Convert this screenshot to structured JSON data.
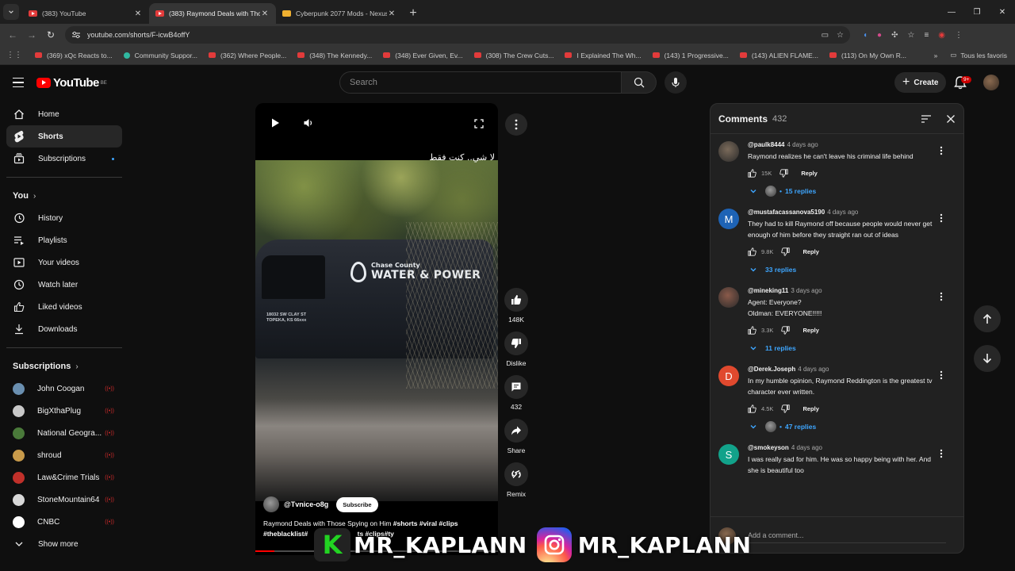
{
  "browser": {
    "tabs": [
      {
        "title": "(383) YouTube",
        "active": false
      },
      {
        "title": "(383) Raymond Deals with Tho",
        "active": true
      },
      {
        "title": "Cyberpunk 2077 Mods - Nexus",
        "active": false
      }
    ],
    "url": "youtube.com/shorts/F-icwB4offY",
    "bookmarks": [
      "(369) xQc Reacts to...",
      "Community Suppor...",
      "(362) Where People...",
      "(348) The Kennedy...",
      "(348) Ever Given, Ev...",
      "(308) The Crew Cuts...",
      "I Explained The Wh...",
      "(143) 1 Progressive...",
      "(143) ALIEN FLAME...",
      "(113) On My Own R..."
    ],
    "all_bookmarks": "Tous les favoris"
  },
  "header": {
    "logo": "YouTube",
    "region": "BE",
    "search_placeholder": "Search",
    "create_label": "Create",
    "notifications": "9+"
  },
  "sidebar": {
    "main": [
      {
        "label": "Home",
        "icon": "home-icon"
      },
      {
        "label": "Shorts",
        "icon": "shorts-icon",
        "active": true
      },
      {
        "label": "Subscriptions",
        "icon": "subscriptions-icon"
      }
    ],
    "you_heading": "You",
    "you": [
      {
        "label": "History",
        "icon": "history-icon"
      },
      {
        "label": "Playlists",
        "icon": "playlists-icon"
      },
      {
        "label": "Your videos",
        "icon": "your-videos-icon"
      },
      {
        "label": "Watch later",
        "icon": "watch-later-icon"
      },
      {
        "label": "Liked videos",
        "icon": "liked-videos-icon"
      },
      {
        "label": "Downloads",
        "icon": "downloads-icon"
      }
    ],
    "subscriptions_heading": "Subscriptions",
    "subscriptions": [
      {
        "label": "John Coogan",
        "color": "#6a8fb0"
      },
      {
        "label": "BigXthaPlug",
        "color": "#c8c8c8"
      },
      {
        "label": "National Geogra...",
        "color": "#4a7a3a"
      },
      {
        "label": "shroud",
        "color": "#c89a4a"
      },
      {
        "label": "Law&Crime Trials",
        "color": "#c0302a"
      },
      {
        "label": "StoneMountain64",
        "color": "#d8d8d8"
      },
      {
        "label": "CNBC",
        "color": "#ffffff"
      }
    ],
    "show_more": "Show more"
  },
  "video": {
    "overlay_text": "لا شي.. كنت فقط",
    "van_small": "Chase County",
    "van_big": "WATER & POWER",
    "van_address": [
      "18032 SW CLAY ST",
      "TOPEKA, KS 66xxx"
    ],
    "channel": "@Tvnice-o8g",
    "subscribe_label": "Subscribe",
    "caption_plain": "Raymond Deals with Those Spying on Him ",
    "caption_tags": "#shorts #viral #clips",
    "caption_line2": "#theblacklist#",
    "caption_line2_tail": "ts #clips#ty",
    "progress": 0.08
  },
  "actions": {
    "likes": "148K",
    "dislike_label": "Dislike",
    "comments": "432",
    "share_label": "Share",
    "remix_label": "Remix"
  },
  "comments": {
    "title": "Comments",
    "count": "432",
    "items": [
      {
        "handle": "@paulk8444",
        "time": "4 days ago",
        "text": "Raymond realizes he can't leave his criminal life behind",
        "likes": "15K",
        "replies": "15 replies",
        "avatar_color": "#7a6a5a",
        "avatar_letter": "",
        "reply_avatar": true
      },
      {
        "handle": "@mustafacassanova5190",
        "time": "4 days ago",
        "text": "They had to kill Raymond off because people would never get enough of him before they straight ran out of ideas",
        "likes": "9.8K",
        "replies": "33 replies",
        "avatar_color": "#1e63b5",
        "avatar_letter": "M",
        "reply_avatar": false
      },
      {
        "handle": "@mineking11",
        "time": "3 days ago",
        "text": "Agent: Everyone?\nOldman: EVERYONE!!!!!",
        "likes": "3.3K",
        "replies": "11 replies",
        "avatar_color": "#8a5a4a",
        "avatar_letter": "",
        "reply_avatar": false
      },
      {
        "handle": "@Derek.Joseph",
        "time": "4 days ago",
        "text": "In my humble opinion, Raymond Reddington is the greatest tv character ever written.",
        "likes": "4.5K",
        "replies": "47 replies",
        "avatar_color": "#e0492e",
        "avatar_letter": "D",
        "reply_avatar": true
      },
      {
        "handle": "@smokeyson",
        "time": "4 days ago",
        "text": "I was really sad for him. He was so happy being with her.  And she is beautiful too",
        "likes": "",
        "replies": "",
        "avatar_color": "#12a28a",
        "avatar_letter": "S",
        "reply_avatar": false
      }
    ],
    "reply_label": "Reply",
    "add_placeholder": "Add a comment..."
  },
  "watermark": {
    "k_letter": "K",
    "text1": "MR_KAPLANN",
    "text2": "MR_KAPLANN"
  }
}
